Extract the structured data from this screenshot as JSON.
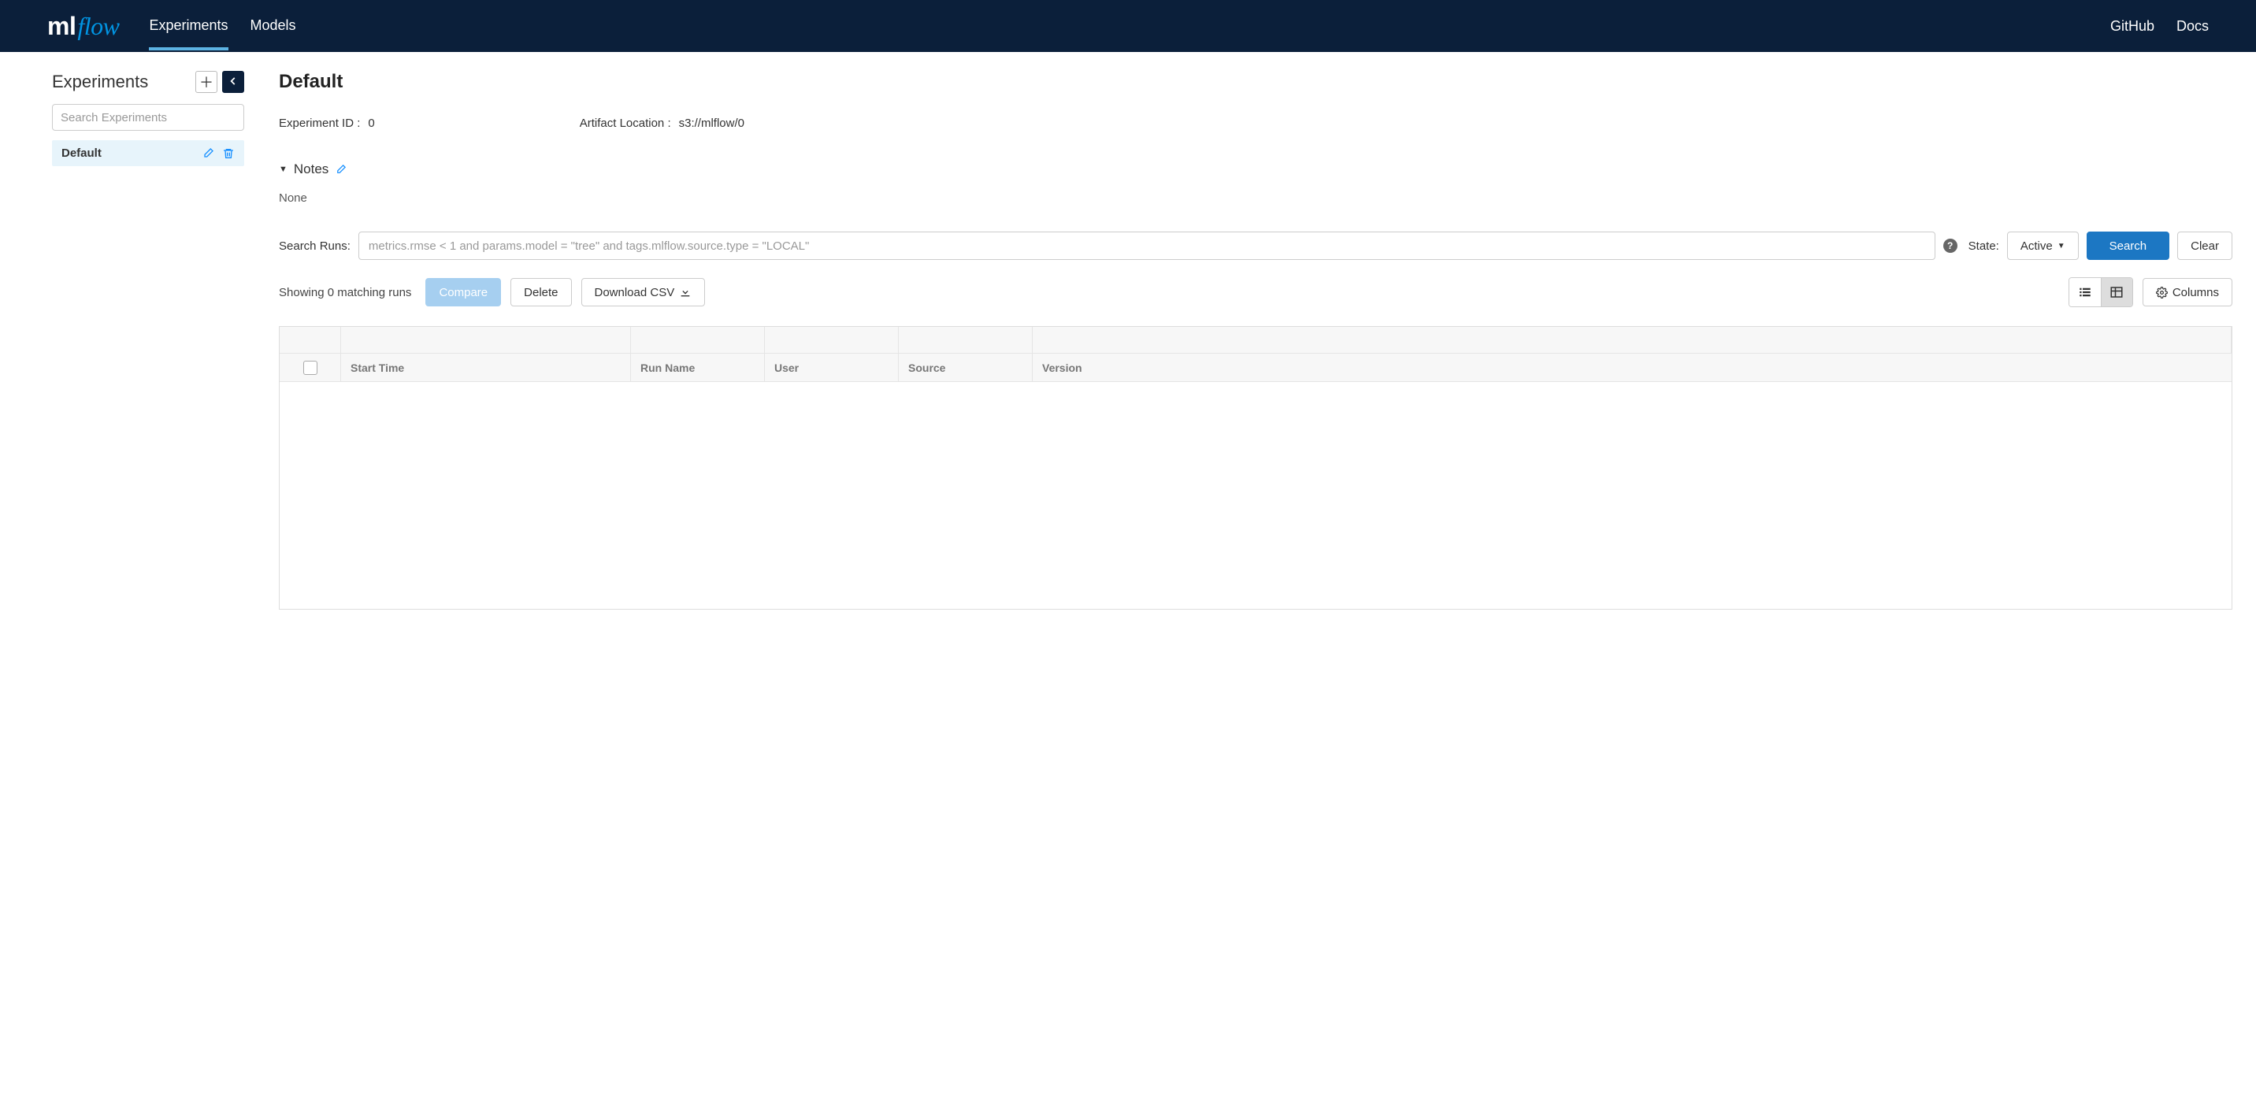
{
  "topbar": {
    "logo_ml": "ml",
    "logo_flow": "flow",
    "tabs": {
      "experiments": "Experiments",
      "models": "Models"
    },
    "links": {
      "github": "GitHub",
      "docs": "Docs"
    }
  },
  "sidebar": {
    "title": "Experiments",
    "search_placeholder": "Search Experiments",
    "items": [
      {
        "name": "Default"
      }
    ]
  },
  "main": {
    "title": "Default",
    "experiment_id_label": "Experiment ID :",
    "experiment_id_value": "0",
    "artifact_location_label": "Artifact Location :",
    "artifact_location_value": "s3://mlflow/0",
    "notes_label": "Notes",
    "notes_value": "None",
    "search_runs_label": "Search Runs:",
    "search_runs_placeholder": "metrics.rmse < 1 and params.model = \"tree\" and tags.mlflow.source.type = \"LOCAL\"",
    "state_label": "State:",
    "state_value": "Active",
    "search_button": "Search",
    "clear_button": "Clear",
    "matching_text": "Showing 0 matching runs",
    "compare_button": "Compare",
    "delete_button": "Delete",
    "download_csv_button": "Download CSV",
    "columns_button": "Columns",
    "table_columns": {
      "start_time": "Start Time",
      "run_name": "Run Name",
      "user": "User",
      "source": "Source",
      "version": "Version"
    }
  }
}
